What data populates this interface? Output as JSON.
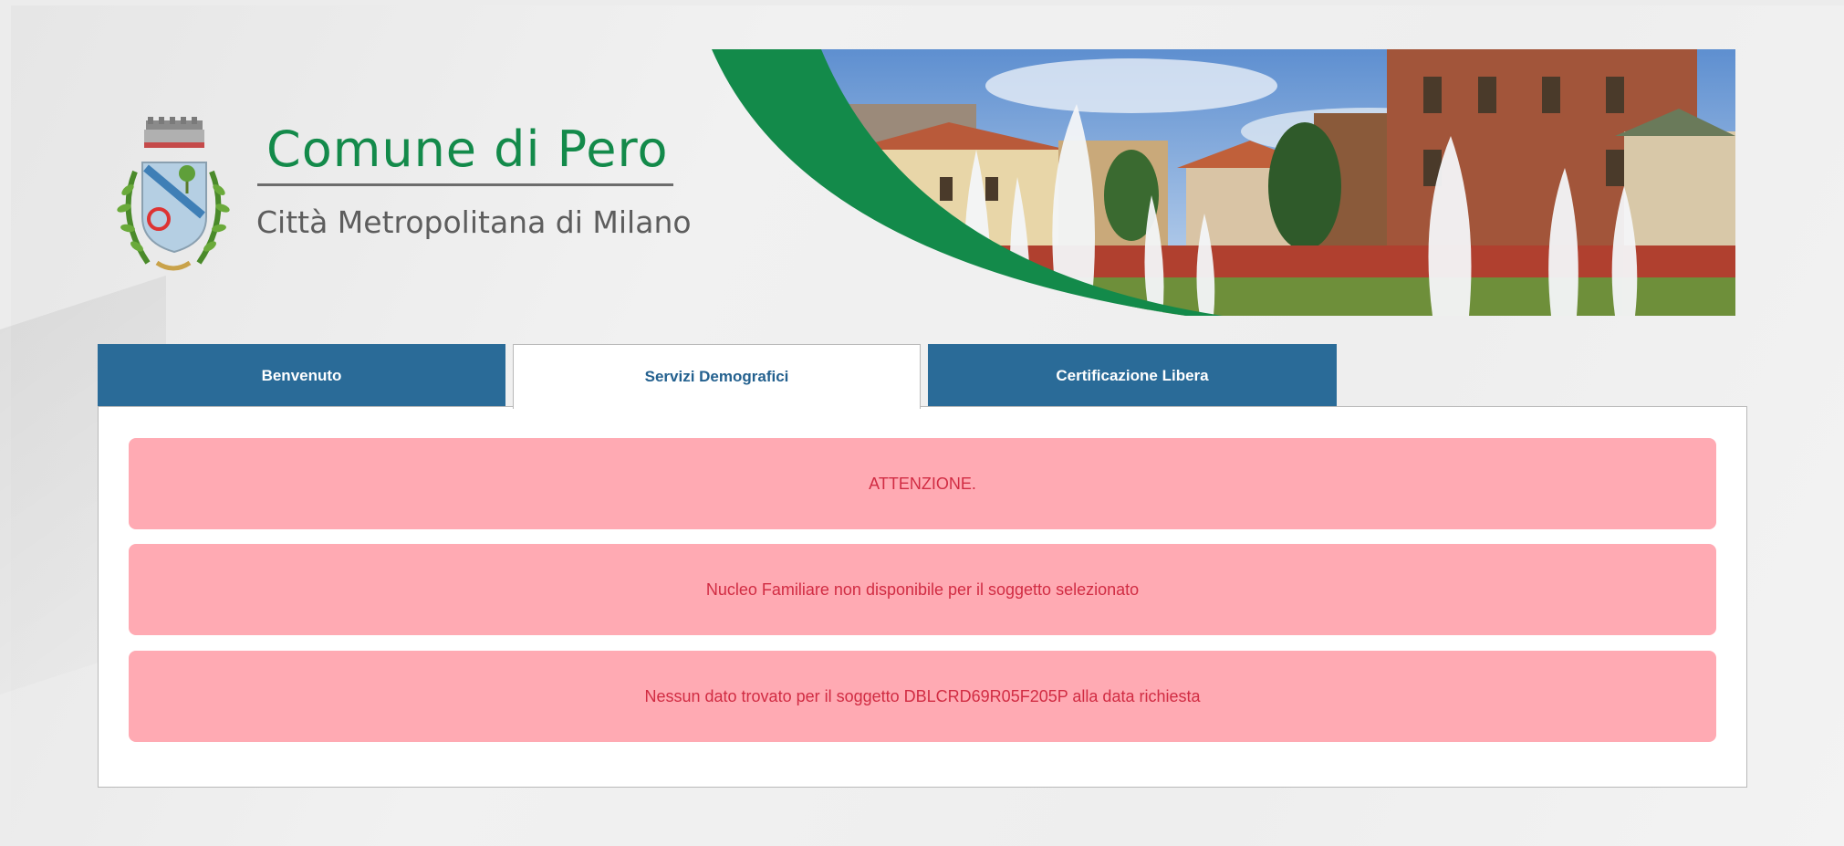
{
  "header": {
    "town_name": "Comune di Pero",
    "town_subtitle": "Città Metropolitana di Milano"
  },
  "tabs": [
    {
      "label": "Benvenuto",
      "active": false
    },
    {
      "label": "Servizi Demografici",
      "active": true
    },
    {
      "label": "Certificazione Libera",
      "active": false
    }
  ],
  "alerts": [
    {
      "text": "ATTENZIONE."
    },
    {
      "text": "Nucleo Familiare non disponibile per il soggetto selezionato"
    },
    {
      "text": "Nessun dato trovato per il soggetto DBLCRD69R05F205P alla data richiesta"
    }
  ],
  "colors": {
    "brand_green": "#138a4a",
    "tab_blue": "#2a6b98",
    "alert_bg": "#ffaab3",
    "alert_text": "#d12c43"
  }
}
